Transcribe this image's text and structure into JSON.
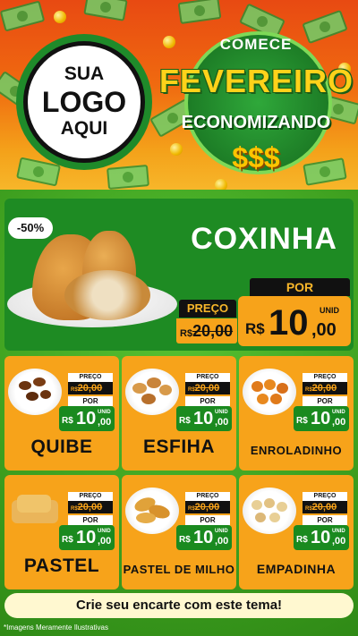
{
  "header": {
    "logo_placeholder": [
      "SUA",
      "LOGO",
      "AQUI"
    ],
    "campaign": {
      "line1": "COMECE",
      "line2": "FEVEREIRO",
      "line3": "ECONOMIZANDO",
      "symbols": "$$$"
    }
  },
  "featured": {
    "discount_badge": "-50%",
    "name": "COXINHA",
    "old_price_label": "PREÇO",
    "old_price_currency": "R$",
    "old_price_value": "20,00",
    "new_price_label": "POR",
    "new_price_currency": "R$",
    "new_price_int": "10",
    "new_price_dec": ",00",
    "unit": "UNID"
  },
  "products": [
    {
      "name": "QUIBE",
      "old_label": "PREÇO",
      "old_cur": "R$",
      "old": "20,00",
      "por": "POR",
      "cur": "R$",
      "int": "10",
      "dec": ",00",
      "unit": "UNID"
    },
    {
      "name": "ESFIHA",
      "old_label": "PREÇO",
      "old_cur": "R$",
      "old": "20,00",
      "por": "POR",
      "cur": "R$",
      "int": "10",
      "dec": ",00",
      "unit": "UNID"
    },
    {
      "name": "ENROLADINHO",
      "old_label": "PREÇO",
      "old_cur": "R$",
      "old": "20,00",
      "por": "POR",
      "cur": "R$",
      "int": "10",
      "dec": ",00",
      "unit": "UNID"
    },
    {
      "name": "PASTEL",
      "old_label": "PREÇO",
      "old_cur": "R$",
      "old": "20,00",
      "por": "POR",
      "cur": "R$",
      "int": "10",
      "dec": ",00",
      "unit": "UNID"
    },
    {
      "name": "PASTEL DE MILHO",
      "old_label": "PREÇO",
      "old_cur": "R$",
      "old": "20,00",
      "por": "POR",
      "cur": "R$",
      "int": "10",
      "dec": ",00",
      "unit": "UNID"
    },
    {
      "name": "EMPADINHA",
      "old_label": "PREÇO",
      "old_cur": "R$",
      "old": "20,00",
      "por": "POR",
      "cur": "R$",
      "int": "10",
      "dec": ",00",
      "unit": "UNID"
    }
  ],
  "footer": {
    "cta": "Crie seu encarte com este tema!",
    "disclaimer": "*Imagens Meramente Ilustrativas"
  },
  "colors": {
    "orange": "#f7a31a",
    "green_dark": "#1e8b23",
    "green_bg": "#3e9f1f",
    "header_red": "#e84a12",
    "black": "#111111",
    "cream": "#fff8d0"
  },
  "icons": [
    "money-bill-icon",
    "coin-icon"
  ]
}
